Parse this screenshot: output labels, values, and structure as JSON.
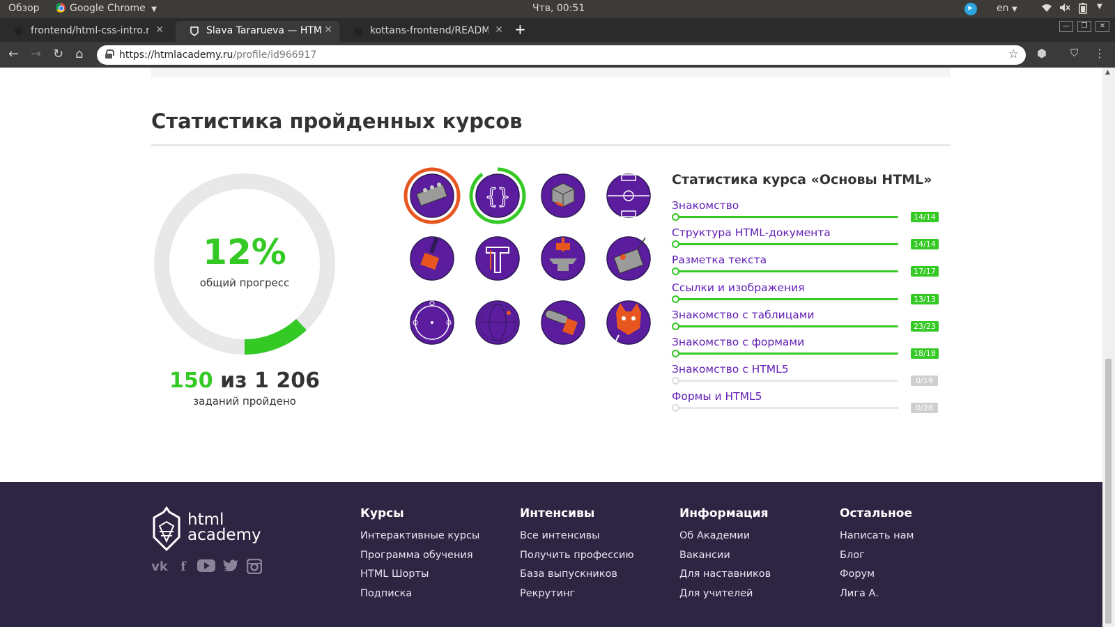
{
  "os": {
    "activities": "Обзор",
    "app_name": "Google Chrome",
    "clock": "Чтв, 00:51",
    "lang": "en"
  },
  "browser": {
    "tabs": [
      {
        "label": "frontend/html-css-intro.n"
      },
      {
        "label": "Slava Tararueva — HTML A"
      },
      {
        "label": "kottans-frontend/READM"
      }
    ],
    "url_host": "https://htmlacademy.ru",
    "url_path": "/profile/id966917"
  },
  "stats": {
    "section_title": "Статистика пройденных курсов",
    "progress_percent": 12,
    "progress_label": "12%",
    "progress_caption": "общий прогресс",
    "tasks_done": "150",
    "tasks_of": "из",
    "tasks_total": "1 206",
    "tasks_caption": "заданий пройдено"
  },
  "badges": [
    {
      "name": "lego-badge",
      "icon": "lego-brick-icon",
      "progress": 1.0,
      "ring_color": "#e8561f",
      "active": true
    },
    {
      "name": "braces-badge",
      "icon": "braces-icon",
      "progress": 0.9,
      "ring_color": "#34c924",
      "active": true
    },
    {
      "name": "rubik-badge",
      "icon": "rubik-cube-icon",
      "progress": 0
    },
    {
      "name": "field-badge",
      "icon": "football-field-icon",
      "progress": 0
    },
    {
      "name": "brush-badge",
      "icon": "paint-brush-icon",
      "progress": 0
    },
    {
      "name": "typography-badge",
      "icon": "letter-t-icon",
      "progress": 0
    },
    {
      "name": "anvil-badge",
      "icon": "anvil-hammer-icon",
      "progress": 0
    },
    {
      "name": "robot-badge",
      "icon": "robot-icon",
      "progress": 0
    },
    {
      "name": "vector-badge",
      "icon": "bezier-circle-icon",
      "progress": 0
    },
    {
      "name": "globe-badge",
      "icon": "globe-icon",
      "progress": 0
    },
    {
      "name": "chainsaw-badge",
      "icon": "chainsaw-icon",
      "progress": 0
    },
    {
      "name": "cat-badge",
      "icon": "cat-icon",
      "progress": 0
    }
  ],
  "course": {
    "title": "Статистика курса «Основы HTML»",
    "lessons": [
      {
        "name": "Знакомство",
        "count": "14/14",
        "progress": 1
      },
      {
        "name": "Структура HTML-документа",
        "count": "14/14",
        "progress": 1
      },
      {
        "name": "Разметка текста",
        "count": "17/17",
        "progress": 1
      },
      {
        "name": "Ссылки и изображения",
        "count": "13/13",
        "progress": 1
      },
      {
        "name": "Знакомство с таблицами",
        "count": "23/23",
        "progress": 1
      },
      {
        "name": "Знакомство с формами",
        "count": "18/18",
        "progress": 1
      },
      {
        "name": "Знакомство с HTML5",
        "count": "0/19",
        "progress": 0
      },
      {
        "name": "Формы и HTML5",
        "count": "0/28",
        "progress": 0
      }
    ]
  },
  "footer": {
    "logo_line1": "html",
    "logo_line2": "academy",
    "columns": [
      {
        "title": "Курсы",
        "links": [
          "Интерактивные курсы",
          "Программа обучения",
          "HTML Шорты",
          "Подписка"
        ]
      },
      {
        "title": "Интенсивы",
        "links": [
          "Все интенсивы",
          "Получить профессию",
          "База выпускников",
          "Рекрутинг"
        ]
      },
      {
        "title": "Информация",
        "links": [
          "Об Академии",
          "Вакансии",
          "Для наставников",
          "Для учителей"
        ]
      },
      {
        "title": "Остальное",
        "links": [
          "Написать нам",
          "Блог",
          "Форум",
          "Лига А."
        ]
      }
    ],
    "socials": [
      "vk-icon",
      "facebook-icon",
      "youtube-icon",
      "twitter-icon",
      "instagram-icon"
    ]
  },
  "colors": {
    "accent_green": "#34c924",
    "accent_purple": "#5f1cb4",
    "footer_bg": "#2d2542",
    "badge_purple": "#5b1d9e"
  }
}
